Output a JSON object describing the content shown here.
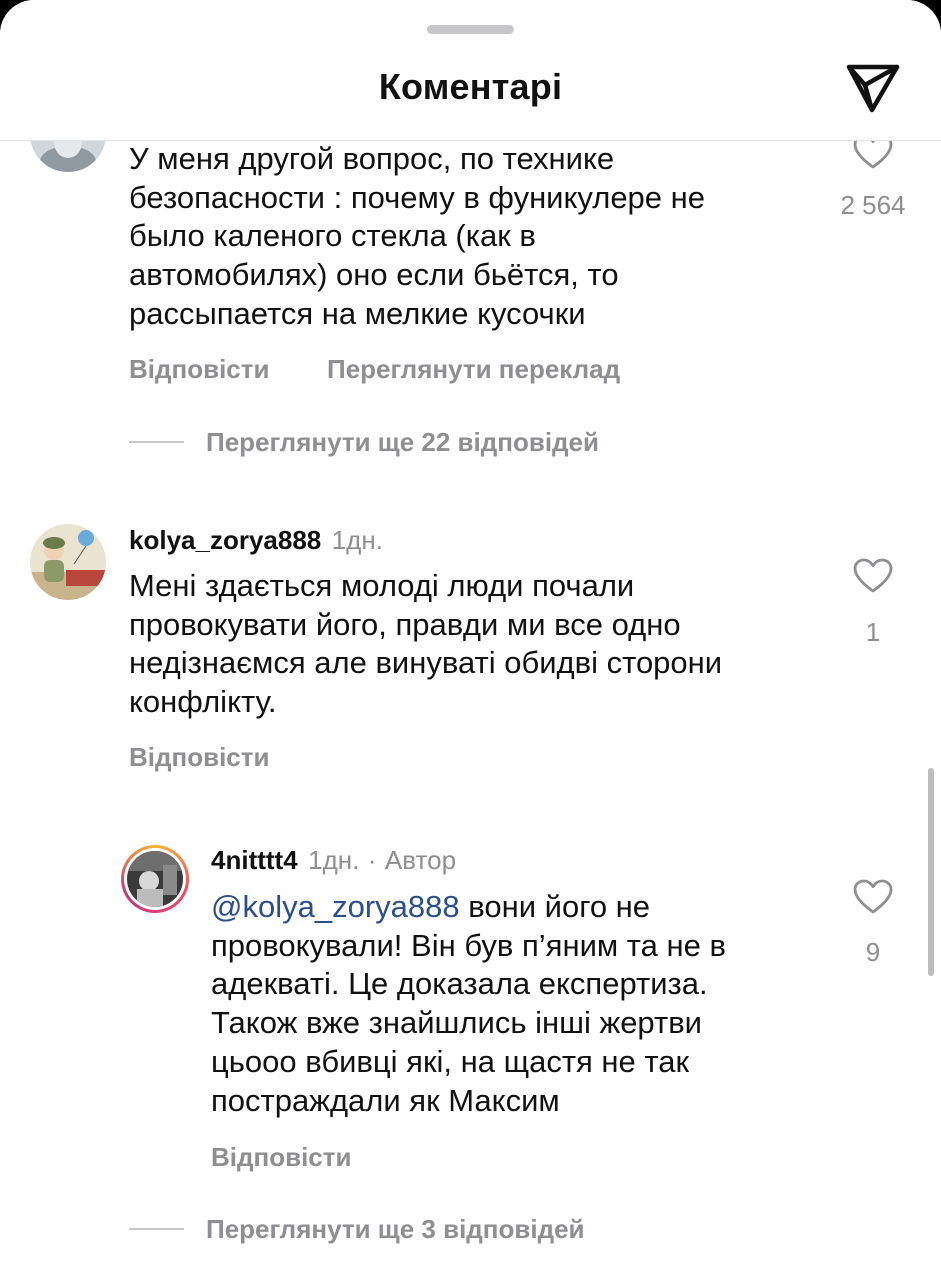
{
  "header": {
    "title": "Коментарі"
  },
  "comment_top": {
    "text": "У меня другой вопрос, по технике\nбезопасности : почему в фуникулере не\nбыло каленого стекла (как в\nавтомобилях) оно если бьётся, то\nрассыпается на мелкие кусочки",
    "likes": "2 564",
    "reply_label": "Відповісти",
    "translate_label": "Переглянути переклад",
    "view_replies": "Переглянути ще 22 відповідей"
  },
  "comment_kolya": {
    "username": "kolya_zorya888",
    "time": "1дн.",
    "text": "Мені здається молоді люди почали\nпровокувати його, правди ми все одно\nнедізнаємся але винуваті обидві сторони\nконфлікту.",
    "likes": "1",
    "reply_label": "Відповісти"
  },
  "reply_author": {
    "username": "4nitttt4",
    "time": "1дн.",
    "separator": "·",
    "badge": "Автор",
    "mention": "@kolya_zorya888",
    "text": " вони його не\nпровокували! Він був п’яним та не в\nадекваті. Це доказала експертиза.\nТакож вже знайшлись інші жертви\nцьооо вбивці які, на щастя не так\nпостраждали як Максим",
    "likes": "9",
    "reply_label": "Відповісти",
    "view_replies": "Переглянути ще 3 відповідей"
  },
  "colors": {
    "mention": "#2b4e8c",
    "secondary_text": "#8e8e93"
  }
}
